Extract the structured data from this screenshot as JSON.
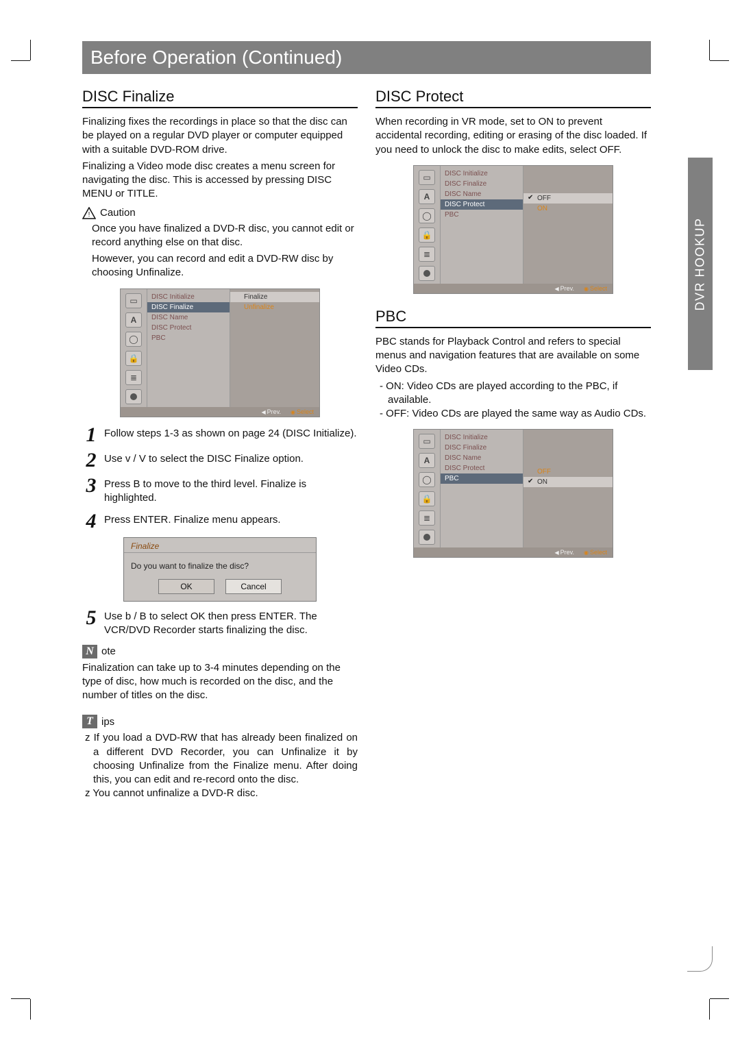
{
  "banner": "Before Operation (Continued)",
  "side_tab": "DVR HOOKUP",
  "left": {
    "title": "DISC Finalize",
    "intro1": "Finalizing fixes the recordings in place so that the disc can be played on a regular DVD player or computer equipped with a suitable DVD-ROM drive.",
    "intro2": "Finalizing a Video mode disc creates a menu screen for navigating the disc. This is accessed by pressing DISC MENU or TITLE.",
    "caution_label": "Caution",
    "caution1": "Once you have finalized a DVD-R disc, you cannot edit or record anything else on that disc.",
    "caution2": "However, you can record and edit a DVD-RW disc by choosing Unfinalize.",
    "osd": {
      "items": [
        "DISC Initialize",
        "DISC Finalize",
        "DISC Name",
        "DISC Protect",
        "PBC"
      ],
      "opts": [
        "Finalize",
        "Unfinalize"
      ],
      "prev": "Prev.",
      "select": "Select"
    },
    "steps": [
      "Follow steps 1-3 as shown on page 24 (DISC Initialize).",
      "Use v / V to select the DISC Finalize option.",
      "Press B to move to the third level. Finalize is highlighted.",
      "Press ENTER. Finalize menu appears.",
      "Use b / B to select OK then press ENTER. The VCR/DVD Recorder starts finalizing the disc."
    ],
    "dialog": {
      "title": "Finalize",
      "body": "Do you want to finalize the disc?",
      "ok": "OK",
      "cancel": "Cancel"
    },
    "note_label": "ote",
    "note_text": "Finalization can take up to 3-4 minutes depending on the type of disc, how much is recorded on the disc, and the number of titles on the disc.",
    "tips_label": "ips",
    "tips": [
      "If you load a DVD-RW that has already been finalized on a different DVD Recorder, you can Unfinalize it by choosing Unfinalize from the Finalize menu. After doing this, you can edit and re-record onto the disc.",
      "You cannot unfinalize a DVD-R disc."
    ]
  },
  "right": {
    "protect": {
      "title": "DISC Protect",
      "text": "When recording in VR mode, set to ON to prevent accidental recording, editing or erasing of the disc loaded. If you need to unlock the disc to make edits, select OFF.",
      "osd": {
        "items": [
          "DISC Initialize",
          "DISC Finalize",
          "DISC Name",
          "DISC Protect",
          "PBC"
        ],
        "opts": [
          "OFF",
          "ON"
        ],
        "prev": "Prev.",
        "select": "Select"
      }
    },
    "pbc": {
      "title": "PBC",
      "text": "PBC stands for Playback Control and refers to special menus and navigation features that are available on some Video CDs.",
      "opts_text": [
        "ON: Video CDs are played according to the PBC, if available.",
        "OFF: Video CDs are played the same way as Audio CDs."
      ],
      "osd": {
        "items": [
          "DISC Initialize",
          "DISC Finalize",
          "DISC Name",
          "DISC Protect",
          "PBC"
        ],
        "opts": [
          "OFF",
          "ON"
        ],
        "prev": "Prev.",
        "select": "Select"
      }
    }
  }
}
